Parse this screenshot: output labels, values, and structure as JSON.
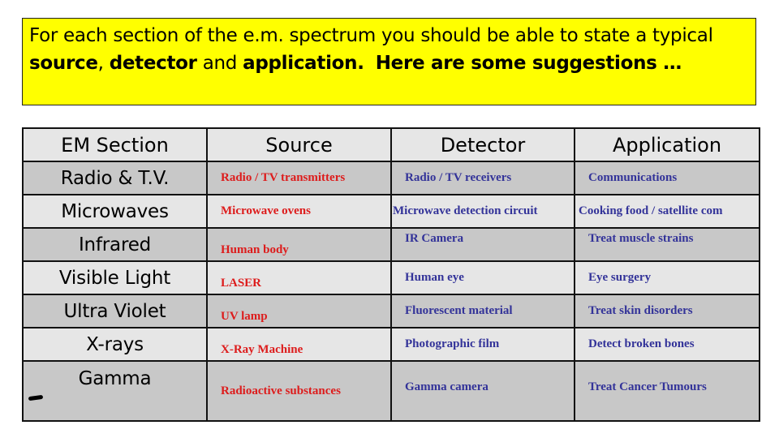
{
  "intro": {
    "part1": "For each section of the e.m. spectrum you should be able to state a typical ",
    "bold1": "source",
    "part2": ", ",
    "bold2": "detector",
    "part3": " and ",
    "bold3": "application.",
    "part4": "  ",
    "bold4": "Here are some suggestions …",
    "background_color": "#ffff00"
  },
  "table": {
    "headers": [
      "EM Section",
      "Source",
      "Detector",
      "Application"
    ],
    "colors": {
      "source": "#dd1c1c",
      "detector": "#333399",
      "application": "#333399"
    },
    "rows": [
      {
        "section": "Radio & T.V.",
        "source": "Radio / TV transmitters",
        "detector": "Radio / TV receivers",
        "application": "Communications"
      },
      {
        "section": "Microwaves",
        "source": "Microwave ovens",
        "detector": "Microwave detection circuit",
        "application": "Cooking food / satellite com"
      },
      {
        "section": "Infrared",
        "source": "Human body",
        "detector": "IR Camera",
        "application": "Treat muscle strains"
      },
      {
        "section": "Visible Light",
        "source": "LASER",
        "detector": "Human eye",
        "application": "Eye surgery"
      },
      {
        "section": "Ultra Violet",
        "source": "UV lamp",
        "detector": "Fluorescent material",
        "application": "Treat skin disorders"
      },
      {
        "section": "X-rays",
        "source": "X-Ray Machine",
        "detector": "Photographic film",
        "application": "Detect broken bones"
      },
      {
        "section": "Gamma",
        "source": "Radioactive substances",
        "detector": "Gamma camera",
        "application": "Treat Cancer Tumours"
      }
    ]
  }
}
